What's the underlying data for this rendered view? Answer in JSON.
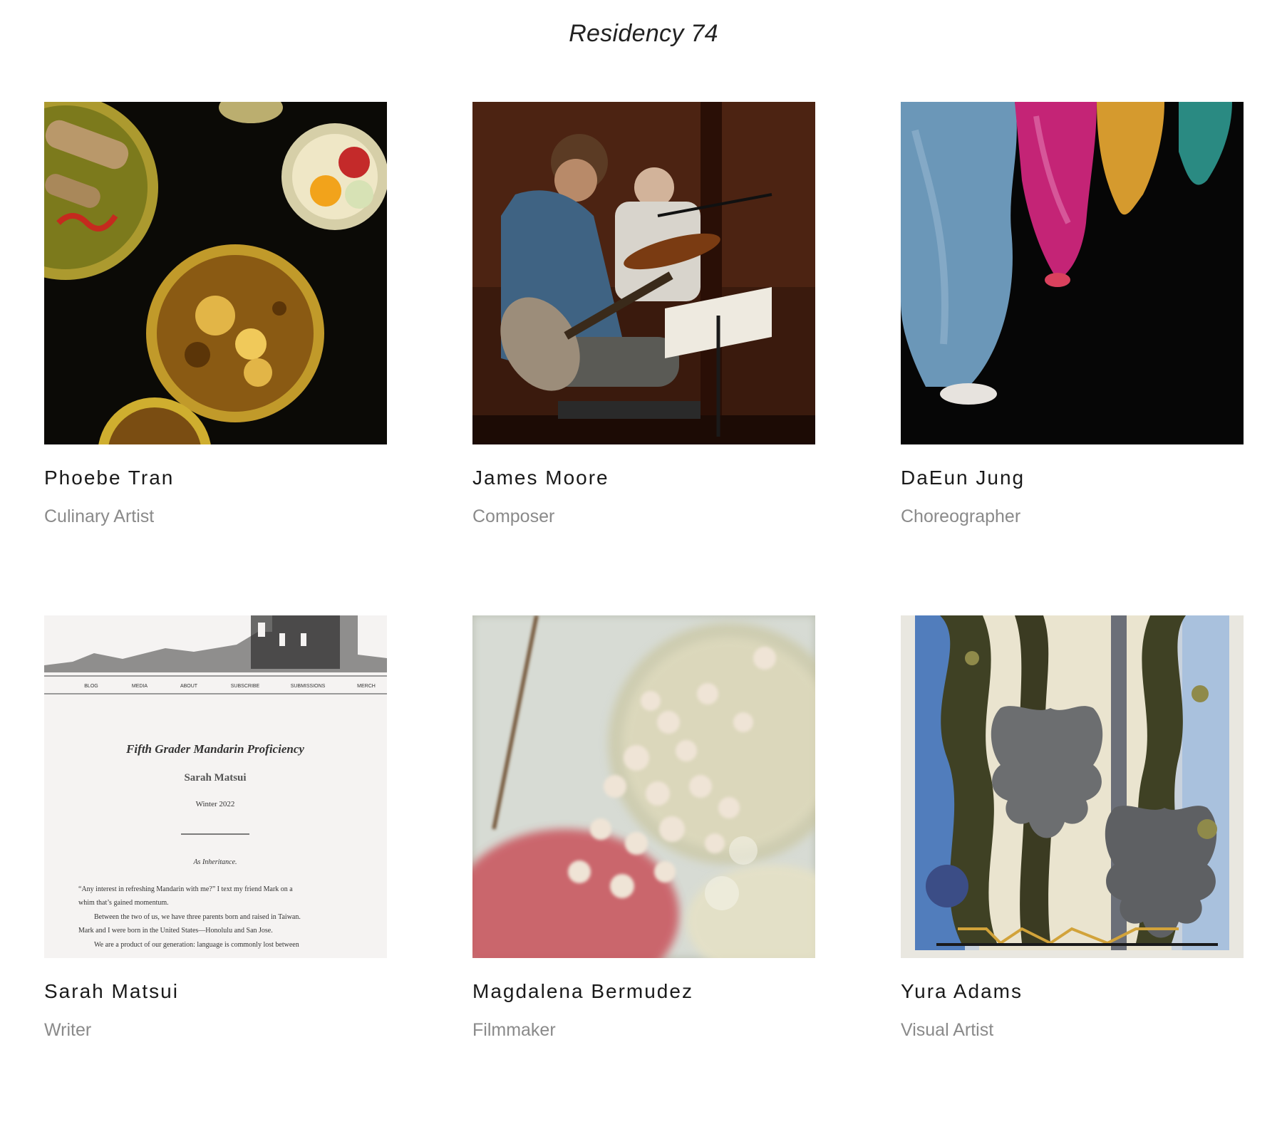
{
  "page": {
    "title": "Residency 74"
  },
  "artists": [
    {
      "name": "Phoebe Tran",
      "role": "Culinary Artist"
    },
    {
      "name": "James Moore",
      "role": "Composer"
    },
    {
      "name": "DaEun Jung",
      "role": "Choreographer"
    },
    {
      "name": "Sarah Matsui",
      "role": "Writer",
      "screenshot": {
        "nav": [
          "BLOG",
          "MEDIA",
          "ABOUT",
          "SUBSCRIBE",
          "SUBMISSIONS",
          "MERCH"
        ],
        "article_title": "Fifth Grader Mandarin Proficiency",
        "author": "Sarah Matsui",
        "date": "Winter 2022",
        "epigraph": "As Inheritance.",
        "body_lines": [
          "“Any interest in refreshing Mandarin with me?” I text my friend Mark on a",
          "whim that’s gained momentum.",
          "Between the two of us, we have three parents born and raised in Taiwan.",
          "Mark and I were born in the United States—Honolulu and San Jose.",
          "We are a product of our generation: language is commonly lost between"
        ]
      }
    },
    {
      "name": "Magdalena Bermudez",
      "role": "Filmmaker"
    },
    {
      "name": "Yura Adams",
      "role": "Visual Artist"
    }
  ]
}
